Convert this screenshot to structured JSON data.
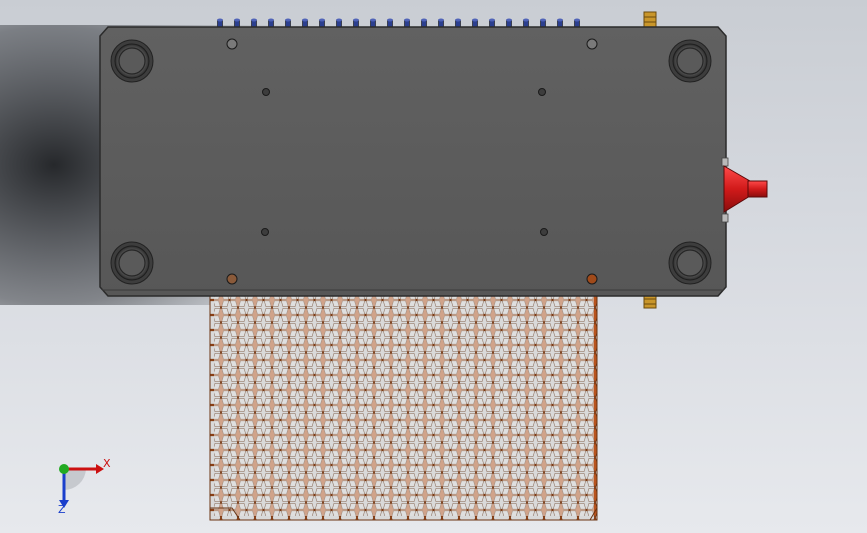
{
  "view": {
    "type": "cad-3d-viewport",
    "background_top": "#c9cdd3",
    "background_bottom": "#e7e9ed"
  },
  "model": {
    "plate_color": "#5c5c5c",
    "edge_color": "#2b2b2b",
    "nozzle_color": "#d11a1a",
    "mesh_color": "#b8541e",
    "pin_color": "#2b3f8f",
    "brass_color": "#c9962a",
    "top_pin_count": 22,
    "guide_bushings": 4,
    "small_holes": 8
  },
  "triad": {
    "x_label": "X",
    "z_label": "Z",
    "x_color": "#cc1010",
    "y_color": "#22aa22",
    "z_color": "#1a3fcc"
  }
}
